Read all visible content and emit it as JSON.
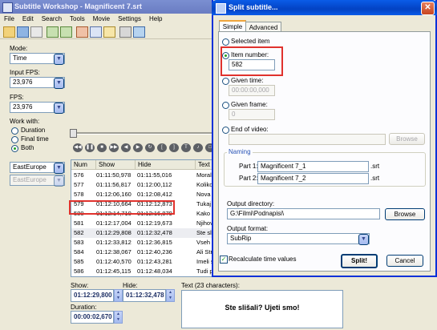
{
  "main_window": {
    "title": "Subtitle Workshop - Magnificent 7.srt",
    "menu": [
      "File",
      "Edit",
      "Search",
      "Tools",
      "Movie",
      "Settings",
      "Help"
    ],
    "mode": {
      "label": "Mode:",
      "value": "Time"
    },
    "input_fps": {
      "label": "Input FPS:",
      "value": "23,976"
    },
    "fps": {
      "label": "FPS:",
      "value": "23,976"
    },
    "work_with": {
      "label": "Work with:",
      "options": [
        "Duration",
        "Final time",
        "Both"
      ],
      "selected": "Both"
    },
    "charset1": "EastEurope",
    "charset2": "EastEurope",
    "table": {
      "columns": [
        "Num",
        "Show",
        "Hide",
        "Text"
      ],
      "rows": [
        [
          "576",
          "01:11:50,978",
          "01:11:55,016",
          "Moral"
        ],
        [
          "577",
          "01:11:56,817",
          "01:12:00,112",
          "Koliko"
        ],
        [
          "578",
          "01:12:06,160",
          "01:12:08,412",
          "Nova"
        ],
        [
          "579",
          "01:12:10,664",
          "01:12:12,873",
          "Tukaj"
        ],
        [
          "580",
          "01:12:14,710",
          "01:12:16,879",
          "Kako"
        ],
        [
          "581",
          "01:12:17,004",
          "01:12:19,673",
          "Njihov"
        ],
        [
          "582",
          "01:12:29,808",
          "01:12:32,478",
          "Ste sli"
        ],
        [
          "583",
          "01:12:33,812",
          "01:12:36,815",
          "Vseh"
        ],
        [
          "584",
          "01:12:38,067",
          "01:12:40,236",
          "Ali Stra"
        ],
        [
          "585",
          "01:12:40,570",
          "01:12:43,281",
          "Imeli s"
        ],
        [
          "586",
          "01:12:45,115",
          "01:12:48,034",
          "Tudi p"
        ]
      ],
      "selected_row": "582"
    },
    "show": {
      "label": "Show:",
      "value": "01:12:29,800"
    },
    "hide": {
      "label": "Hide:",
      "value": "01:12:32,478"
    },
    "duration": {
      "label": "Duration:",
      "value": "00:00:02,670"
    },
    "text_panel": {
      "label": "Text (23 characters):",
      "value": "Ste slišali? Ujeti smo!"
    }
  },
  "split_dialog": {
    "title": "Split subtitle...",
    "tabs": [
      "Simple",
      "Advanced"
    ],
    "active_tab": "Simple",
    "options": {
      "selected_item": "Selected item",
      "item_number": "Item number:",
      "item_number_value": "582",
      "given_time": "Given time:",
      "given_time_value": "00:00:00,000",
      "given_frame": "Given frame:",
      "given_frame_value": "0",
      "end_of_video": "End of video:",
      "end_of_video_value": ""
    },
    "selected_option": "Item number",
    "browse_label": "Browse",
    "naming": {
      "label": "Naming",
      "part1_label": "Part 1:",
      "part1_value": "Magnificent 7_1",
      "part2_label": "Part 2:",
      "part2_value": "Magnificent 7_2",
      "ext": ".srt"
    },
    "output_directory": {
      "label": "Output directory:",
      "value": "G:\\Filmi\\Podnapisi\\"
    },
    "output_format": {
      "label": "Output format:",
      "value": "SubRip"
    },
    "recalculate": {
      "label": "Recalculate time values",
      "checked": true
    },
    "split_button": "Split!",
    "cancel_button": "Cancel"
  }
}
